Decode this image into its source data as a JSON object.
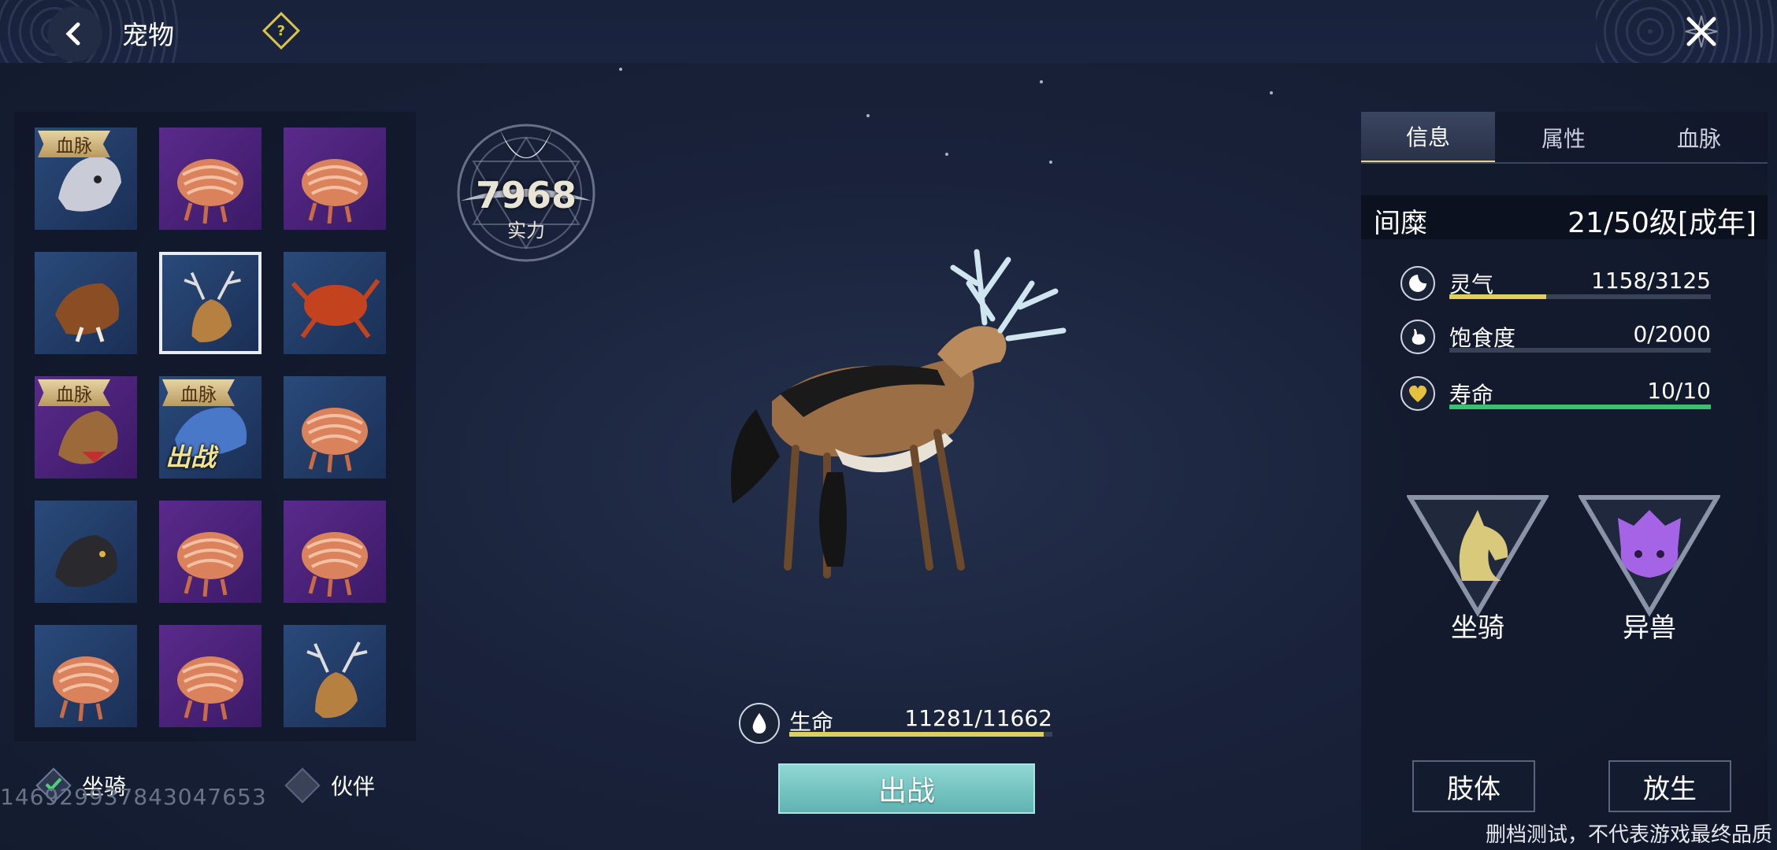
{
  "header": {
    "title": "宠物",
    "help_icon": "help-diamond-icon",
    "close_icon": "close-x-icon"
  },
  "pet_grid": [
    {
      "color": "blue",
      "tag": "血脉",
      "creature": "white-beast"
    },
    {
      "color": "purple",
      "tag": "",
      "creature": "shrimp-beast"
    },
    {
      "color": "purple",
      "tag": "",
      "creature": "shrimp-beast"
    },
    {
      "color": "blue",
      "tag": "",
      "creature": "boar"
    },
    {
      "color": "blue",
      "tag": "",
      "creature": "deer",
      "selected": true
    },
    {
      "color": "blue",
      "tag": "",
      "creature": "crab"
    },
    {
      "color": "purple",
      "tag": "血脉",
      "creature": "wolf"
    },
    {
      "color": "blue",
      "tag": "血脉",
      "creature": "blue-beast",
      "status": "出战"
    },
    {
      "color": "blue",
      "tag": "",
      "creature": "shrimp-beast"
    },
    {
      "color": "blue",
      "tag": "",
      "creature": "black-bear"
    },
    {
      "color": "purple",
      "tag": "",
      "creature": "shrimp-beast"
    },
    {
      "color": "purple",
      "tag": "",
      "creature": "shrimp-beast"
    },
    {
      "color": "blue",
      "tag": "",
      "creature": "shrimp-beast"
    },
    {
      "color": "purple",
      "tag": "",
      "creature": "shrimp-beast"
    },
    {
      "color": "blue",
      "tag": "",
      "creature": "deer"
    }
  ],
  "filters": {
    "mount": "坐骑",
    "partner": "伙伴"
  },
  "uid": "1469299378430476​53",
  "power": {
    "value": "7968",
    "label": "实力"
  },
  "hp": {
    "label": "生命",
    "value": "11281/11662",
    "fraction": 0.967
  },
  "deploy_button": "出战",
  "tabs": [
    "信息",
    "属性",
    "血脉"
  ],
  "pet": {
    "name": "间糜",
    "level": "21/50级[成年]"
  },
  "stats": [
    {
      "label": "灵气",
      "value": "1158/3125",
      "fraction": 0.37,
      "color": "#e0cf5a",
      "icon": "spirit-swirl-icon"
    },
    {
      "label": "饱食度",
      "value": "0/2000",
      "fraction": 0.0,
      "color": "#e0cf5a",
      "icon": "stomach-icon"
    },
    {
      "label": "寿命",
      "value": "10/10",
      "fraction": 1.0,
      "color": "#3fbf6a",
      "icon": "heart-icon"
    }
  ],
  "types": [
    {
      "label": "坐骑",
      "icon": "horse-head-icon",
      "color": "#d9c97a"
    },
    {
      "label": "异兽",
      "icon": "beast-head-icon",
      "color": "#a563e6"
    }
  ],
  "buttons": {
    "limbs": "肢体",
    "release": "放生"
  },
  "disclaimer": "删档测试，不代表游戏最终品质"
}
